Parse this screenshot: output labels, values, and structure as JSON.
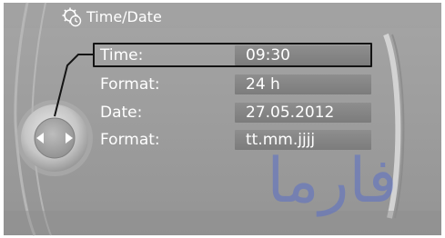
{
  "header": {
    "title": "Time/Date",
    "icon": "settings-clock-icon"
  },
  "settings": {
    "rows": [
      {
        "label": "Time:",
        "value": "09:30",
        "selected": true
      },
      {
        "label": "Format:",
        "value": "24 h",
        "selected": false
      },
      {
        "label": "Date:",
        "value": "27.05.2012",
        "selected": false
      },
      {
        "label": "Format:",
        "value": "tt.mm.jjjj",
        "selected": false
      }
    ]
  },
  "controller": {
    "icon": "controller-knob-icon",
    "left_arrow": "left-arrow-icon",
    "right_arrow": "right-arrow-icon"
  },
  "watermark": {
    "text": "فارما"
  },
  "colors": {
    "screen_bg": "#9a9a9a",
    "value_field": "#868686",
    "selection_border": "#141414",
    "text": "#ffffff",
    "watermark": "#5a6fc8"
  }
}
